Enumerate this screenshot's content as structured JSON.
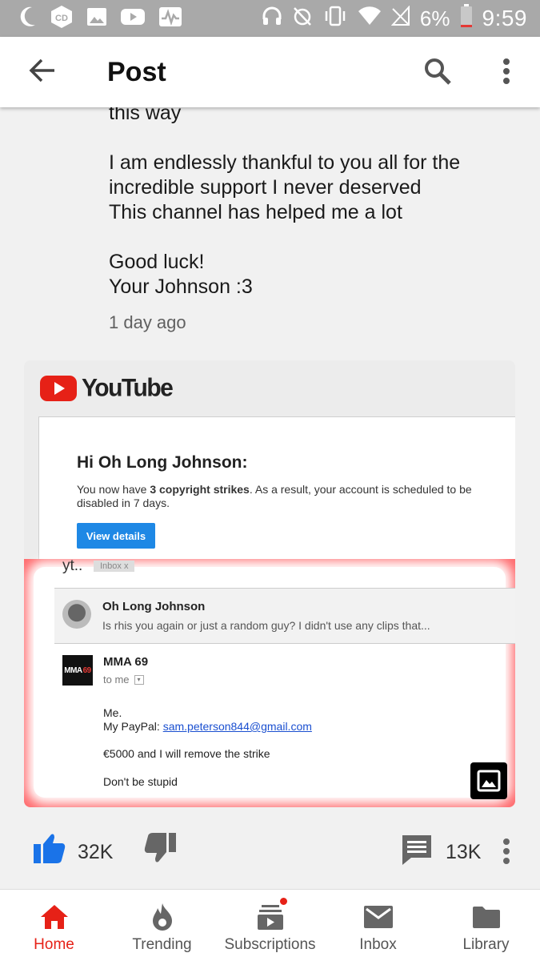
{
  "status_bar": {
    "battery": "6%",
    "time": "9:59"
  },
  "app_bar": {
    "title": "Post"
  },
  "post": {
    "text_lines": [
      "this way",
      "",
      "I am endlessly thankful to you all for the",
      "incredible support I never deserved",
      "This channel has helped me a lot",
      "",
      "Good luck!",
      "Your Johnson :3"
    ],
    "time_ago": "1 day ago"
  },
  "embedded_image": {
    "brand": "YouTube",
    "email": {
      "heading": "Hi Oh Long Johnson:",
      "body_before": "You now have ",
      "body_bold": "3 copyright strikes",
      "body_after": ". As a result, your account is scheduled to be disabled in 7 days.",
      "button": "View details"
    },
    "mail_client": {
      "folder_prefix": "yt..",
      "inbox_tag": "Inbox   x",
      "thread": {
        "sender": "Oh Long Johnson",
        "snippet": "Is rhis you again or just a random guy? I didn't use any clips that..."
      },
      "message": {
        "avatar_text": "MMA",
        "avatar_num": "69",
        "sender": "MMA 69",
        "to": "to me",
        "line1": "Me.",
        "line2_prefix": "My PayPal: ",
        "line2_email": "sam.peterson844@gmail.com",
        "line3": "€5000 and I will remove the strike",
        "line4": "Don't be stupid"
      }
    }
  },
  "actions": {
    "likes": "32K",
    "comments": "13K"
  },
  "bottom_nav": {
    "items": [
      {
        "label": "Home",
        "icon": "home-icon",
        "active": true
      },
      {
        "label": "Trending",
        "icon": "flame-icon"
      },
      {
        "label": "Subscriptions",
        "icon": "subscriptions-icon"
      },
      {
        "label": "Inbox",
        "icon": "mail-icon"
      },
      {
        "label": "Library",
        "icon": "folder-icon"
      }
    ]
  },
  "colors": {
    "accent_red": "#e62117",
    "like_blue": "#1a73e8",
    "highlight_red": "#ff6b6e"
  }
}
